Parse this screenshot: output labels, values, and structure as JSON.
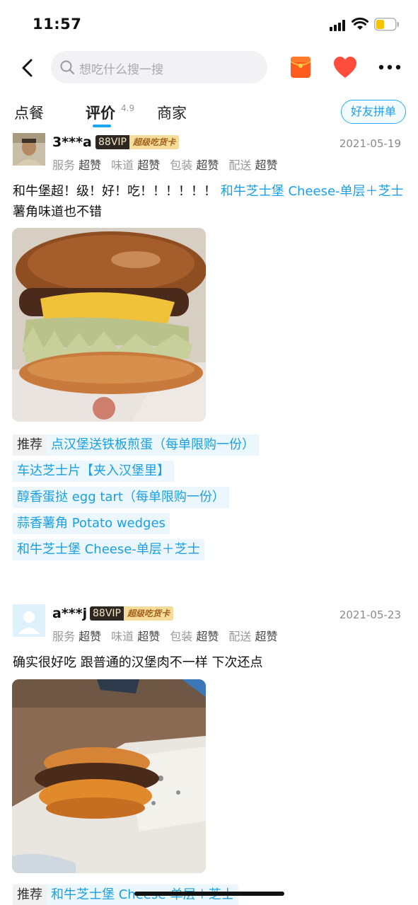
{
  "status_bar": {
    "time": "11:57"
  },
  "header": {
    "search_placeholder": "想吃什么搜一搜"
  },
  "tabs": {
    "order": "点餐",
    "reviews": "评价",
    "reviews_score": "4.9",
    "merchant": "商家",
    "friend_group": "好友拼单"
  },
  "colors": {
    "accent": "#1aa0e8",
    "heart": "#ff4d3d",
    "redpacket": "#ff5a1f"
  },
  "reviews": [
    {
      "username": "3***a",
      "vip_level": "88VIP",
      "vip_card": "超级吃货卡",
      "date": "2021-05-19",
      "ratings": [
        {
          "label": "服务",
          "value": "超赞"
        },
        {
          "label": "味道",
          "value": "超赞"
        },
        {
          "label": "包装",
          "value": "超赞"
        },
        {
          "label": "配送",
          "value": "超赞"
        }
      ],
      "text_before": "和牛堡超！级！好！吃！！！！！！ ",
      "dish_link": "和牛芝士堡 Cheese-单层＋芝士",
      "text_after": " 薯角味道也不错",
      "rec_label": "推荐",
      "recommended": [
        "点汉堡送铁板煎蛋（每单限购一份）",
        "车达芝士片【夹入汉堡里】",
        "醇香蛋挞 egg tart（每单限购一份）",
        "蒜香薯角 Potato wedges",
        "和牛芝士堡 Cheese-单层＋芝士"
      ]
    },
    {
      "username": "a***j",
      "vip_level": "88VIP",
      "vip_card": "超级吃货卡",
      "date": "2021-05-23",
      "ratings": [
        {
          "label": "服务",
          "value": "超赞"
        },
        {
          "label": "味道",
          "value": "超赞"
        },
        {
          "label": "包装",
          "value": "超赞"
        },
        {
          "label": "配送",
          "value": "超赞"
        }
      ],
      "text": "确实很好吃 跟普通的汉堡肉不一样 下次还点",
      "rec_label": "推荐",
      "recommended": [
        "和牛芝士堡 Cheese-单层＋芝士"
      ]
    }
  ]
}
